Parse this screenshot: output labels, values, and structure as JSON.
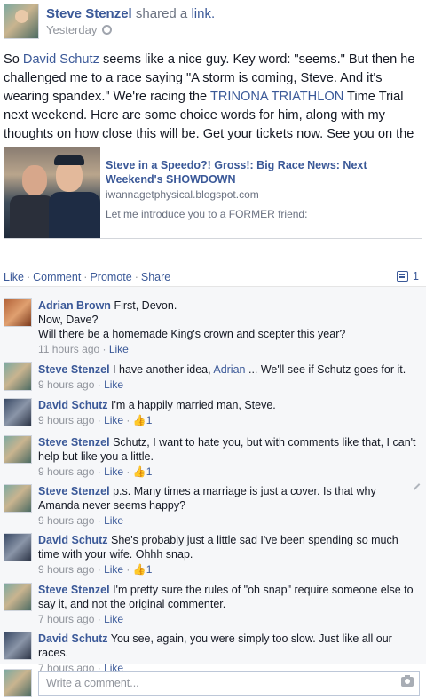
{
  "post": {
    "author": "Steve Stenzel",
    "verb": "shared a",
    "object_link": "link.",
    "timestamp": "Yesterday",
    "text_parts": [
      "So ",
      "David Schutz",
      " seems like a nice guy. Key word: \"seems.\" But then he challenged me to a race saying \"A storm is coming, Steve. And it's wearing spandex.\" We're racing the ",
      "TRINONA TRIATHLON",
      " Time Trial next weekend. Here are some choice words for him, along with my thoughts on how close this will be. Get your tickets now. See you on the Bluff, Schutz."
    ]
  },
  "link_card": {
    "title": "Steve in a Speedo?! Gross!: Big Race News: Next Weekend's SHOWDOWN",
    "domain": "iwannagetphysical.blogspot.com",
    "description": "Let me introduce you to a FORMER friend:"
  },
  "actions": {
    "like": "Like",
    "comment": "Comment",
    "promote": "Promote",
    "share": "Share",
    "separator": "·",
    "comment_count": "1"
  },
  "comments": [
    {
      "author": "Adrian Brown",
      "text": "First, Devon.",
      "extra_lines": [
        "Now, Dave?",
        "Will there be a homemade King's crown and scepter this year?"
      ],
      "time": "11 hours ago",
      "like": "Like",
      "likes": ""
    },
    {
      "author": "Steve Stenzel",
      "text_before": "I have another idea, ",
      "mention": "Adrian",
      "text_after": " ... We'll see if Schutz goes for it.",
      "time": "9 hours ago",
      "like": "Like",
      "likes": ""
    },
    {
      "author": "David Schutz",
      "text": "I'm a happily married man, Steve.",
      "time": "9 hours ago",
      "like": "Like",
      "likes": "1"
    },
    {
      "author": "Steve Stenzel",
      "text": "Schutz, I want to hate you, but with comments like that, I can't help but like you a little.",
      "time": "9 hours ago",
      "like": "Like",
      "likes": "1"
    },
    {
      "author": "Steve Stenzel",
      "text": "p.s. Many times a marriage is just a cover. Is that why Amanda never seems happy?",
      "time": "9 hours ago",
      "like": "Like",
      "likes": ""
    },
    {
      "author": "David Schutz",
      "text": "She's probably just a little sad I've been spending so much time with your wife. Ohhh snap.",
      "time": "9 hours ago",
      "like": "Like",
      "likes": "1"
    },
    {
      "author": "Steve Stenzel",
      "text": "I'm pretty sure the rules of \"oh snap\" require someone else to say it, and not the original commenter.",
      "time": "7 hours ago",
      "like": "Like",
      "likes": ""
    },
    {
      "author": "David Schutz",
      "text": "You see, again, you were simply too slow. Just like all our races.",
      "time": "7 hours ago",
      "like": "Like",
      "likes": ""
    }
  ],
  "write_comment": {
    "placeholder": "Write a comment..."
  },
  "icons": {
    "privacy": "globe-icon",
    "comments": "comment-bubble-icon",
    "thumbs_up": "thumbs-up-icon",
    "edit": "pencil-icon",
    "photo": "camera-icon"
  },
  "colors": {
    "link": "#3b5998",
    "meta": "#90949c",
    "comments_bg": "#f6f7f9"
  }
}
